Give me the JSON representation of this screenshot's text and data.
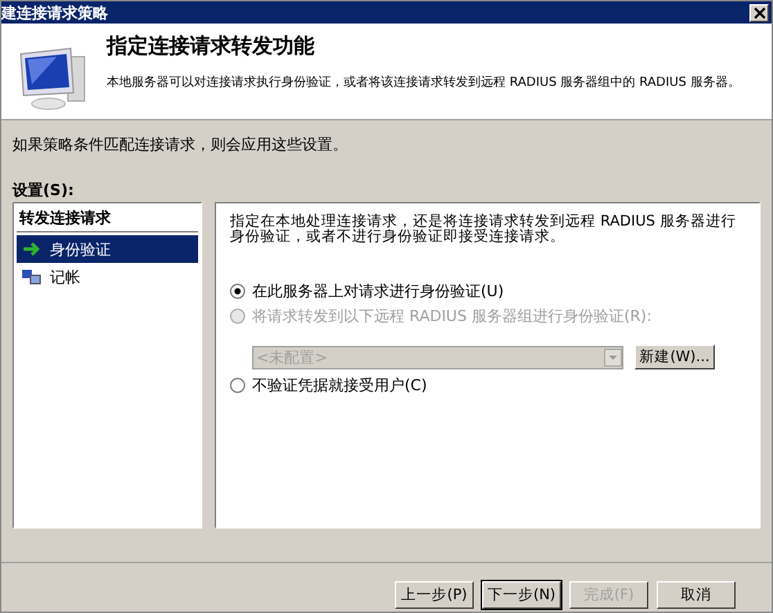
{
  "window": {
    "title": "建连接请求策略"
  },
  "header": {
    "title": "指定连接请求转发功能",
    "description": "本地服务器可以对连接请求执行身份验证，或者将该连接请求转发到远程 RADIUS 服务器组中的 RADIUS 服务器。"
  },
  "info": "如果策略条件匹配连接请求，则会应用这些设置。",
  "settings_label": "设置(S):",
  "sidebar": {
    "group": "转发连接请求",
    "items": [
      {
        "label": "身份验证",
        "kind": "arrow",
        "selected": true
      },
      {
        "label": "记帐",
        "kind": "computers",
        "selected": false
      }
    ]
  },
  "panel": {
    "description": "指定在本地处理连接请求，还是将连接请求转发到远程 RADIUS 服务器进行身份验证，或者不进行身份验证即接受连接请求。",
    "options": [
      {
        "label": "在此服务器上对请求进行身份验证(U)",
        "selected": true,
        "disabled": false
      },
      {
        "label": "将请求转发到以下远程 RADIUS 服务器组进行身份验证(R):",
        "selected": false,
        "disabled": true
      },
      {
        "label": "不验证凭据就接受用户(C)",
        "selected": false,
        "disabled": false
      }
    ],
    "server_group": {
      "value": "<未配置>",
      "disabled": true
    },
    "new_button": "新建(W)..."
  },
  "buttons": [
    {
      "label": "上一步(P)",
      "disabled": false,
      "default": false
    },
    {
      "label": "下一步(N)",
      "disabled": false,
      "default": true
    },
    {
      "label": "完成(F)",
      "disabled": true,
      "default": false
    },
    {
      "label": "取消",
      "disabled": false,
      "default": false
    }
  ]
}
